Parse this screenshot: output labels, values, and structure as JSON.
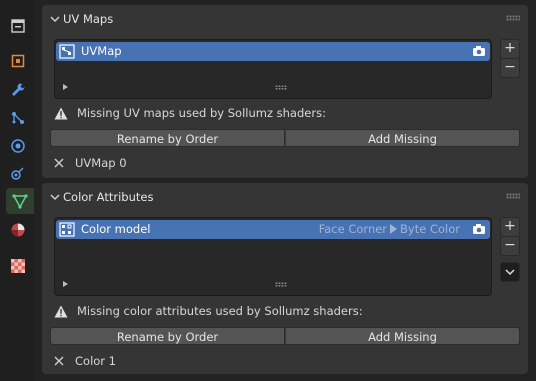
{
  "sidebar": {
    "tabs": [
      {
        "name": "tool-tab",
        "icon": "tool-icon"
      },
      {
        "name": "object-tab",
        "icon": "object-icon"
      },
      {
        "name": "modifier-tab",
        "icon": "wrench-icon"
      },
      {
        "name": "particles-tab",
        "icon": "particles-icon"
      },
      {
        "name": "physics-tab",
        "icon": "physics-icon"
      },
      {
        "name": "constraints-tab",
        "icon": "constraints-icon"
      },
      {
        "name": "data-tab",
        "icon": "mesh-data-icon",
        "active": true
      },
      {
        "name": "material-tab",
        "icon": "material-icon"
      },
      {
        "name": "texture-tab",
        "icon": "texture-icon"
      }
    ]
  },
  "uv_maps": {
    "title": "UV Maps",
    "item_name": "UVMap",
    "warning": "Missing UV maps used by Sollumz shaders:",
    "rename_label": "Rename by Order",
    "add_label": "Add Missing",
    "missing_item": "UVMap 0"
  },
  "color_attributes": {
    "title": "Color Attributes",
    "item_name": "Color model",
    "domain": "Face Corner",
    "data_type": "Byte Color",
    "warning": "Missing color attributes used by Sollumz shaders:",
    "rename_label": "Rename by Order",
    "add_label": "Add Missing",
    "missing_item": "Color 1"
  },
  "list_controls": {
    "add": "+",
    "remove": "−"
  },
  "colors": {
    "selection": "#4772b3",
    "active_tab": "#5fd18b",
    "warning": "#e0e0e0"
  }
}
